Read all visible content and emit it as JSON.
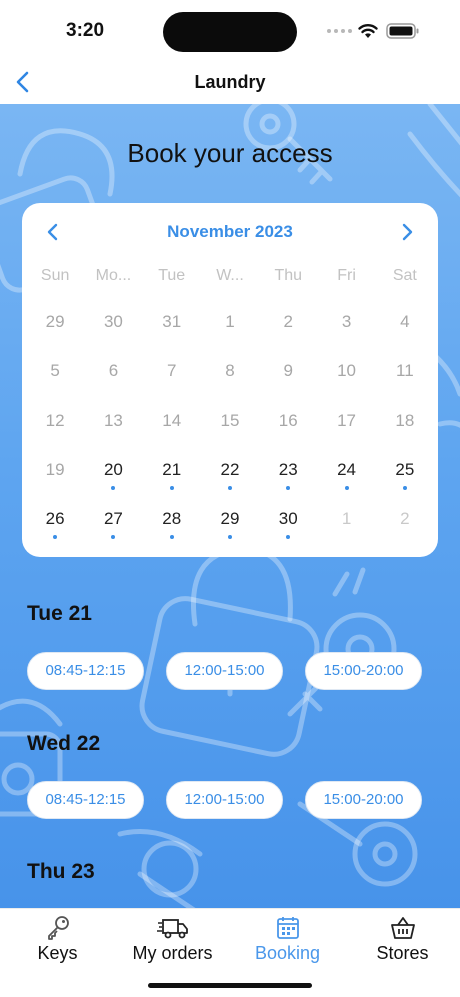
{
  "status_bar": {
    "time": "3:20"
  },
  "nav": {
    "title": "Laundry",
    "back_icon": "chevron-left-icon"
  },
  "header": {
    "title": "Book your access"
  },
  "calendar": {
    "month_label": "November 2023",
    "accent": "#3a8ee6",
    "weekdays": [
      "Sun",
      "Mo...",
      "Tue",
      "W...",
      "Thu",
      "Fri",
      "Sat"
    ],
    "weeks": [
      [
        {
          "d": "29",
          "state": "past"
        },
        {
          "d": "30",
          "state": "past"
        },
        {
          "d": "31",
          "state": "past"
        },
        {
          "d": "1",
          "state": "past"
        },
        {
          "d": "2",
          "state": "past"
        },
        {
          "d": "3",
          "state": "past"
        },
        {
          "d": "4",
          "state": "past"
        }
      ],
      [
        {
          "d": "5",
          "state": "past"
        },
        {
          "d": "6",
          "state": "past"
        },
        {
          "d": "7",
          "state": "past"
        },
        {
          "d": "8",
          "state": "past"
        },
        {
          "d": "9",
          "state": "past"
        },
        {
          "d": "10",
          "state": "past"
        },
        {
          "d": "11",
          "state": "past"
        }
      ],
      [
        {
          "d": "12",
          "state": "past"
        },
        {
          "d": "13",
          "state": "past"
        },
        {
          "d": "14",
          "state": "past"
        },
        {
          "d": "15",
          "state": "past"
        },
        {
          "d": "16",
          "state": "past"
        },
        {
          "d": "17",
          "state": "past"
        },
        {
          "d": "18",
          "state": "past"
        }
      ],
      [
        {
          "d": "19",
          "state": "past"
        },
        {
          "d": "20",
          "state": "available"
        },
        {
          "d": "21",
          "state": "available"
        },
        {
          "d": "22",
          "state": "available"
        },
        {
          "d": "23",
          "state": "available"
        },
        {
          "d": "24",
          "state": "available"
        },
        {
          "d": "25",
          "state": "available"
        }
      ],
      [
        {
          "d": "26",
          "state": "available"
        },
        {
          "d": "27",
          "state": "available"
        },
        {
          "d": "28",
          "state": "available"
        },
        {
          "d": "29",
          "state": "available"
        },
        {
          "d": "30",
          "state": "available"
        },
        {
          "d": "1",
          "state": "next-month"
        },
        {
          "d": "2",
          "state": "next-month"
        }
      ]
    ]
  },
  "days": [
    {
      "label": "Tue 21",
      "slots": [
        "08:45-12:15",
        "12:00-15:00",
        "15:00-20:00"
      ]
    },
    {
      "label": "Wed 22",
      "slots": [
        "08:45-12:15",
        "12:00-15:00",
        "15:00-20:00"
      ]
    },
    {
      "label": "Thu 23",
      "slots": []
    }
  ],
  "tabs": [
    {
      "label": "Keys",
      "icon": "key-icon",
      "active": false
    },
    {
      "label": "My orders",
      "icon": "truck-icon",
      "active": false
    },
    {
      "label": "Booking",
      "icon": "calendar-icon",
      "active": true
    },
    {
      "label": "Stores",
      "icon": "basket-icon",
      "active": false
    }
  ],
  "colors": {
    "tab_active": "#4a97ea",
    "background_top": "#7ab6f3",
    "background_bottom": "#4793ea"
  }
}
